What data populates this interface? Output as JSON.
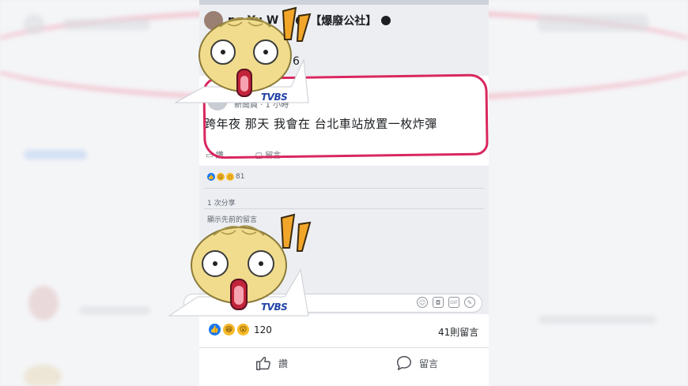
{
  "outer_post": {
    "poster_name": "ng Yu W",
    "group_name": "【爆廢公社】",
    "meta_fragment": "6",
    "reactions_count": "120",
    "comments_count": "41則留言",
    "like_label": "讚",
    "comment_label": "留言"
  },
  "quoted_post": {
    "author": "新聞員 · 1 小時",
    "text": "跨年夜 那天 我會在 台北車站放置一枚炸彈",
    "like_label": "讚",
    "comment_label": "留言",
    "reactions_count": "81",
    "shares": "1 次分享",
    "previous_comments": "顯示先前的留言"
  },
  "watermark": "TVBS",
  "colors": {
    "highlight": "#d9275f",
    "facebook_blue": "#1877f2",
    "bun": "#f0dc8c"
  },
  "icons": [
    "like-reaction-icon",
    "haha-reaction-icon",
    "wow-reaction-icon",
    "thumbs-up-icon",
    "speech-bubble-icon",
    "emoji-icon",
    "camera-icon",
    "gif-icon",
    "sticker-icon",
    "exclamation-icon"
  ]
}
